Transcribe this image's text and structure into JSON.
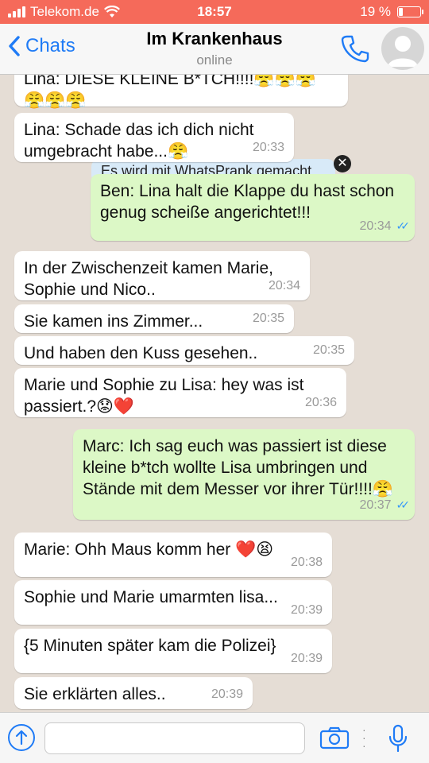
{
  "status_bar": {
    "carrier": "Telekom.de",
    "time": "18:57",
    "battery_text": "19 %",
    "battery_level": 0.19,
    "icons": [
      "signal-icon",
      "wifi-icon",
      "battery-icon"
    ]
  },
  "header": {
    "back_label": "Chats",
    "title": "Im Krankenhaus",
    "status": "online"
  },
  "overlay": {
    "label": "Es wird mit WhatsPrank gemacht",
    "close_glyph": "✕"
  },
  "messages": [
    {
      "dir": "in",
      "text": "Lina: DIESE KLEINE B*TCH!!!!😤😤😤 😤😤😤",
      "time": ""
    },
    {
      "dir": "in",
      "text": "Lina: Schade das ich dich nicht umgebracht habe...😤",
      "time": "20:33"
    },
    {
      "dir": "out",
      "text": "Ben: Lina halt die Klappe du hast schon genug scheiße angerichtet!!!",
      "time": "20:34",
      "read": true
    },
    {
      "dir": "in",
      "text": "In der Zwischenzeit kamen Marie, Sophie und Nico..",
      "time": "20:34"
    },
    {
      "dir": "in",
      "text": "Sie kamen ins Zimmer...",
      "time": "20:35"
    },
    {
      "dir": "in",
      "text": "Und haben den Kuss gesehen..",
      "time": "20:35"
    },
    {
      "dir": "in",
      "text": "Marie und Sophie zu Lisa: hey was ist passiert.?😟❤️",
      "time": "20:36"
    },
    {
      "dir": "out",
      "text": "Marc: Ich sag euch was passiert ist diese kleine b*tch wollte Lisa umbringen und Stände mit dem Messer vor ihrer Tür!!!!😤",
      "time": "20:37",
      "read": true
    },
    {
      "dir": "in",
      "text": "Marie: Ohh Maus komm her ❤️😫",
      "time": "20:38"
    },
    {
      "dir": "in",
      "text": "Sophie und Marie umarmten lisa...",
      "time": "20:39"
    },
    {
      "dir": "in",
      "text": "{5 Minuten später kam die Polizei}",
      "time": "20:39"
    },
    {
      "dir": "in",
      "text": "Sie erklärten alles..",
      "time": "20:39"
    }
  ],
  "input": {
    "value": "",
    "placeholder": ""
  },
  "colors": {
    "status_bar": "#f56a5a",
    "accent": "#1f7bf6",
    "outgoing_bubble": "#dcf8c6",
    "incoming_bubble": "#ffffff",
    "read_tick": "#3497f9"
  }
}
